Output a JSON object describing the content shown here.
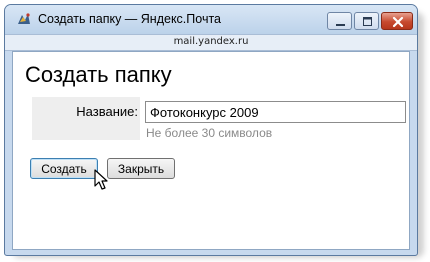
{
  "window": {
    "title": "Создать папку — Яндекс.Почта",
    "url": "mail.yandex.ru",
    "controls": {
      "minimize": "minimize",
      "maximize": "maximize",
      "close": "close"
    }
  },
  "page": {
    "heading": "Создать папку",
    "name_label": "Название:",
    "name_value": "Фотоконкурс 2009",
    "hint": "Не более 30 символов",
    "create_button": "Создать",
    "close_button": "Закрыть"
  },
  "icons": {
    "app": "yandex-mail-icon",
    "cursor": "mouse-pointer-icon"
  },
  "colors": {
    "accent": "#3c7fb1",
    "close_button": "#c74a2f",
    "hint_text": "#8a8a8a"
  }
}
